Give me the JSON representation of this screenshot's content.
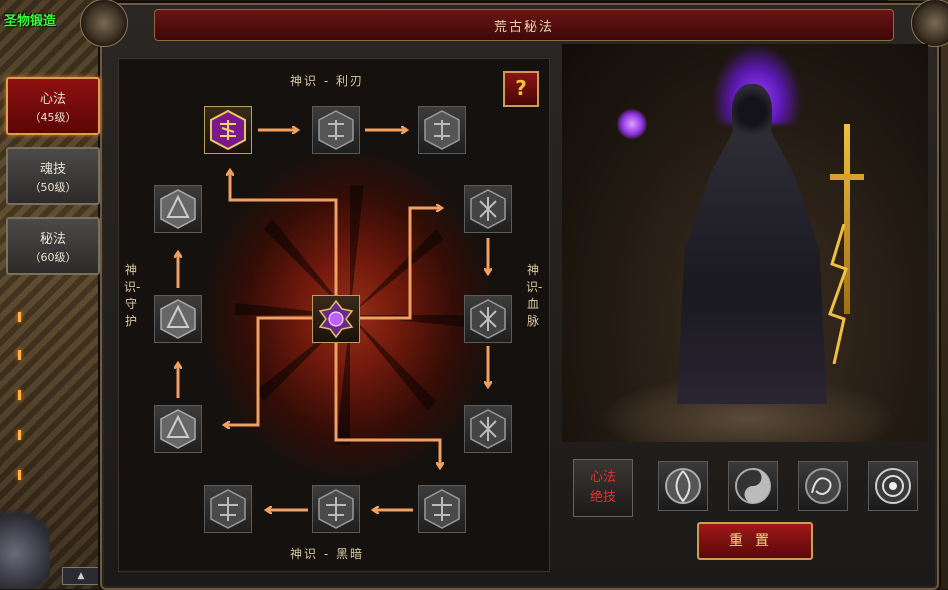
{
  "hud": {
    "top_left_label": "圣物锻造"
  },
  "window": {
    "title": "荒古秘法"
  },
  "tabs": [
    {
      "name": "心法",
      "level": "（45级）",
      "active": true
    },
    {
      "name": "魂技",
      "level": "（50级）",
      "active": false
    },
    {
      "name": "秘法",
      "level": "（60级）",
      "active": false
    }
  ],
  "paths": {
    "top": "神识 - 利刃",
    "bottom": "神识 - 黑暗",
    "left": "神识-守护",
    "right": "神识-血脉"
  },
  "help_button": "?",
  "special_skill": {
    "line1": "心法",
    "line2": "绝技"
  },
  "skill_icons": [
    "swirl-rune-icon",
    "yin-yang-icon",
    "dragon-icon",
    "ring-orb-icon"
  ],
  "reset_button": "重置",
  "colors": {
    "arrow": "#f0a060",
    "active_tab": "#8e1010",
    "gold_border": "#c8a050",
    "special_skill_text": "#e83030",
    "active_node": "#b030c0"
  }
}
